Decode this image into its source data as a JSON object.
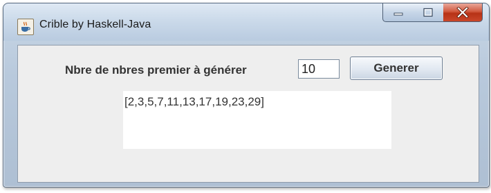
{
  "window": {
    "title": "Crible by Haskell-Java",
    "icon": "java-cup-icon",
    "controls": {
      "minimize_icon": "minimize-icon",
      "maximize_icon": "maximize-icon",
      "close_icon": "close-icon",
      "close_color": "#c9462a"
    }
  },
  "form": {
    "label": "Nbre de nbres premier à générer",
    "count_value": "10",
    "generate_label": "Generer"
  },
  "result": {
    "text": "[2,3,5,7,11,13,17,19,23,29]"
  }
}
